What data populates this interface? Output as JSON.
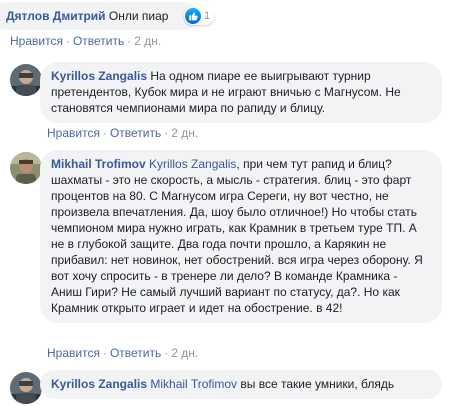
{
  "comments": [
    {
      "author": "Дятлов Дмитрий",
      "text": "Онли пиар",
      "likes": "1",
      "like_label": "Нравится",
      "reply_label": "Ответить",
      "time": "2 дн."
    },
    {
      "author": "Kyrillos Zangalis",
      "text": "На одном пиаре ее выигрывают турнир претендентов, Кубок мира и не играют вничью с Магнусом. Не становятся чемпионами мира по рапиду и блицу.",
      "like_label": "Нравится",
      "reply_label": "Ответить",
      "time": "2 дн."
    },
    {
      "author": "Mikhail Trofimov",
      "mention": "Kyrillos Zangalis",
      "text": ", при чем тут рапид и блиц? шахматы - это не скорость, а мысль - стратегия. блиц - это фарт процентов на 80. С Магнусом игра Сереги, ну вот честно, не произвела впечатления. Да, шоу было отличное!) Но чтобы стать чемпионом мира нужно играть, как Крамник в третьем туре ТП. А не в глубокой защите. Два года почти прошло, а Карякин не прибавил: нет новинок, нет обострений. вся игра через оборону. Я вот хочу спросить - в тренере ли дело? В команде Крамника - Аниш Гири? Не самый лучший вариант по статусу, да?. Но как Крамник открыто играет и идет на обострение. в 42!",
      "like_label": "Нравится",
      "reply_label": "Ответить",
      "time": "2 дн."
    },
    {
      "author": "Kyrillos Zangalis",
      "mention": "Mikhail Trofimov",
      "text": " вы все такие умники, блядь"
    }
  ],
  "colors": {
    "link": "#385898",
    "bubble": "#f2f3f5",
    "meta": "#90949c",
    "like_blue": "#1877f2"
  }
}
